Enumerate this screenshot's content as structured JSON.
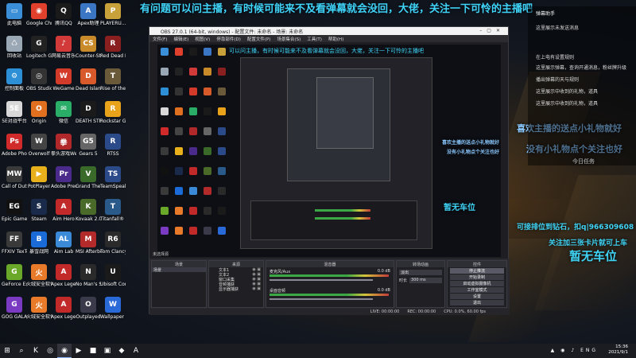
{
  "desktop_icons": [
    {
      "label": "此电脑",
      "color": "#3b8ed8",
      "glyph": "▭"
    },
    {
      "label": "Google Chrome",
      "color": "#e0402c",
      "glyph": "◉"
    },
    {
      "label": "腾讯QQ",
      "color": "#1a1a1a",
      "glyph": "Q"
    },
    {
      "label": "Apex助理",
      "color": "#3a76c4",
      "glyph": "A"
    },
    {
      "label": "PLAYERU... BATTLEGR...",
      "color": "#c9a13a",
      "glyph": "P"
    },
    {
      "label": "回收站",
      "color": "#9aa7b5",
      "glyph": "♺"
    },
    {
      "label": "Logitech G HUB",
      "color": "#222",
      "glyph": "G"
    },
    {
      "label": "网易云音乐",
      "color": "#d23a3a",
      "glyph": "♪"
    },
    {
      "label": "Counter-Str... Global Off...",
      "color": "#c98a2a",
      "glyph": "CS"
    },
    {
      "label": "Red Dead Redempti...",
      "color": "#8a1f1f",
      "glyph": "R"
    },
    {
      "label": "控制面板",
      "color": "#2d8fd5",
      "glyph": "⚙"
    },
    {
      "label": "OBS Studio",
      "color": "#333",
      "glyph": "◎"
    },
    {
      "label": "WeGame",
      "color": "#d43a2a",
      "glyph": "W"
    },
    {
      "label": "Dead Island Riptide Def...",
      "color": "#d85a2a",
      "glyph": "D"
    },
    {
      "label": "Rise of the Tomb Ra...",
      "color": "#6a5a3a",
      "glyph": "T"
    },
    {
      "label": "5E对战平台",
      "color": "#d8d8d8",
      "glyph": "5E"
    },
    {
      "label": "Origin",
      "color": "#e07020",
      "glyph": "O"
    },
    {
      "label": "微信",
      "color": "#2aae67",
      "glyph": "✉"
    },
    {
      "label": "DEATH STRANDING",
      "color": "#1a1a1a",
      "glyph": "D"
    },
    {
      "label": "Rockstar Games...",
      "color": "#e8a31a",
      "glyph": "R"
    },
    {
      "label": "Adobe Photosh...",
      "color": "#d02a2a",
      "glyph": "Ps"
    },
    {
      "label": "Overwolf",
      "color": "#444",
      "glyph": "W"
    },
    {
      "label": "拳头游戏WeGame",
      "color": "#b0282a",
      "glyph": "拳"
    },
    {
      "label": "Gears 5",
      "color": "#666",
      "glyph": "G5"
    },
    {
      "label": "RTSS",
      "color": "#2a4a8a",
      "glyph": "R"
    },
    {
      "label": "Call of Duty Modern ...",
      "color": "#3a3a3a",
      "glyph": "MW"
    },
    {
      "label": "PotPlayer",
      "color": "#e8b01a",
      "glyph": "▶"
    },
    {
      "label": "Adobe Premie...",
      "color": "#4a2a8a",
      "glyph": "Pr"
    },
    {
      "label": "Grand Theft Auto V",
      "color": "#3a6a2a",
      "glyph": "V"
    },
    {
      "label": "TeamSpeak 3 Client",
      "color": "#2a4a8a",
      "glyph": "TS"
    },
    {
      "label": "Epic Games Launcher",
      "color": "#111",
      "glyph": "EG"
    },
    {
      "label": "Steam",
      "color": "#1a2a4a",
      "glyph": "S"
    },
    {
      "label": "Aim Hero",
      "color": "#c22a2a",
      "glyph": "A"
    },
    {
      "label": "Kovaak 2.0",
      "color": "#4a6a2a",
      "glyph": "K"
    },
    {
      "label": "Titanfall® 2",
      "color": "#2a5a8a",
      "glyph": "T"
    },
    {
      "label": "FFXIV TexTools",
      "color": "#3a3a3a",
      "glyph": "FF"
    },
    {
      "label": "暴雪战网",
      "color": "#1a6ad8",
      "glyph": "B"
    },
    {
      "label": "Aim Lab",
      "color": "#3a8ad8",
      "glyph": "AL"
    },
    {
      "label": "MSI Afterburner",
      "color": "#b22a2a",
      "glyph": "M"
    },
    {
      "label": "Tom Clancy's R...",
      "color": "#2a2a2a",
      "glyph": "R6"
    },
    {
      "label": "GeForce Experience",
      "color": "#6aa82a",
      "glyph": "G"
    },
    {
      "label": "火绒安全软件",
      "color": "#e87a2a",
      "glyph": "火"
    },
    {
      "label": "Apex Legends",
      "color": "#c22a2a",
      "glyph": "A"
    },
    {
      "label": "No Man's Sky",
      "color": "#2a2a2a",
      "glyph": "N"
    },
    {
      "label": "Ubisoft Connect",
      "color": "#1a1a1a",
      "glyph": "U"
    },
    {
      "label": "GOG GALAXY",
      "color": "#7a3ac2",
      "glyph": "G"
    },
    {
      "label": "火绒安全软件",
      "color": "#e87a2a",
      "glyph": "火"
    },
    {
      "label": "Apex Legends",
      "color": "#c22a2a",
      "glyph": "A"
    },
    {
      "label": "Outplayed",
      "color": "#3a3a4a",
      "glyph": "O"
    },
    {
      "label": "Wallpaper Engine",
      "color": "#2a6ad8",
      "glyph": "W"
    }
  ],
  "overlay": {
    "scroll_text": "有问题可以问主播，有时候可能来不及看弹幕就会没回，大佬，关注一下可怜的主播吧",
    "inner_scroll_text": "可以问主播，有时候可能来不及看弹幕就会没回，大佬，关注一下可怜的主播吧",
    "line1": "喜欢主播的送点小礼物就好",
    "line2": "没有小礼物点个关注也好",
    "today_task": "今日任务",
    "no_seat_1": "暂无车位",
    "contact": "可接排位到钻石，扣q|966309608",
    "follow": "关注加三张卡片就可上车",
    "no_seat_2": "暂无车位"
  },
  "obs": {
    "title": "OBS 27.0.1 (64-bit, windows) - 配置文件: 未命名 - 场景: 未命名",
    "menu": [
      "文件(F)",
      "编辑(E)",
      "视图(V)",
      "停靠部件(D)",
      "配置文件(P)",
      "场景集合(S)",
      "工具(T)",
      "帮助(H)"
    ],
    "docks": {
      "scenes": {
        "header": "场景",
        "item": "场景"
      },
      "sources": {
        "header": "来源",
        "items": [
          "文本1",
          "文本2",
          "窗口采集",
          "音频捕获",
          "显示器捕获"
        ]
      },
      "mixer": {
        "header": "混音器",
        "tracks": [
          {
            "name": "麦克风/Aux",
            "db": "0.0 dB"
          },
          {
            "name": "桌面音频",
            "db": "0.0 dB"
          }
        ]
      },
      "transition": {
        "header": "转场动画",
        "type": "淡出",
        "duration_label": "时长",
        "duration": "300 ms"
      },
      "controls": {
        "header": "控件",
        "buttons": [
          "停止推流",
          "开始录制",
          "启动虚拟摄像机",
          "工作室模式",
          "设置",
          "退出"
        ]
      }
    },
    "status": [
      "LIVE: 00:00:00",
      "REC: 00:00:00",
      "CPU: 0.0%, 60.00 fps"
    ],
    "no_source_label": "未选择源"
  },
  "chat": {
    "header": "弹幕助手",
    "lines": [
      "这里展示未发送消息",
      "在上电有设置规则",
      "这里展示弹幕，查询开通消息，粉丝牌升级",
      "播出弹幕的天与规则",
      "这里展示中收到的礼物，道具",
      "这里展示中收到的礼物，道具"
    ]
  },
  "taskbar": {
    "start_icon": "⊞",
    "search_icon": "⌕",
    "apps": [
      "K",
      "◎",
      "◉",
      "▶",
      "■",
      "▣",
      "◆",
      "A"
    ],
    "lang": "ENG",
    "time": "15:36",
    "date": "2021/9/1"
  }
}
